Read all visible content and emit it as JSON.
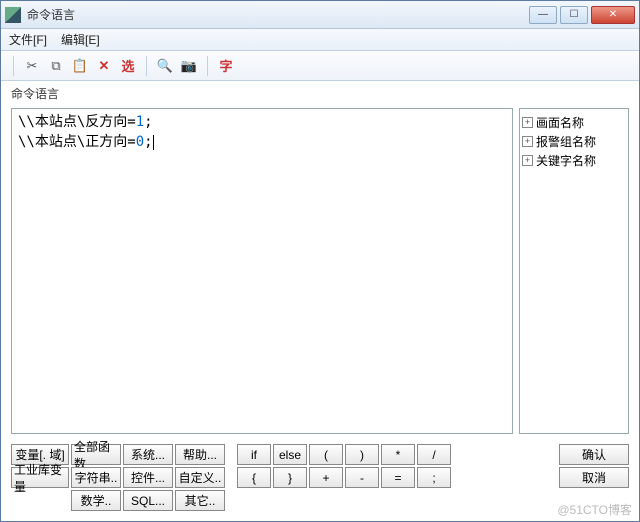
{
  "window": {
    "title": "命令语言"
  },
  "menu": {
    "file": "文件[F]",
    "edit": "编辑[E]"
  },
  "toolbar": {
    "cut": "✂",
    "copy": "⧉",
    "paste": "📋",
    "delete": "✕",
    "select": "选",
    "find": "🔍",
    "camera": "📷",
    "font": "字"
  },
  "panel": {
    "label": "命令语言"
  },
  "code": {
    "lines": [
      {
        "pre": "\\\\本站点\\反方向=",
        "val": "1",
        "post": ";"
      },
      {
        "pre": "\\\\本站点\\正方向=",
        "val": "0",
        "post": ";"
      }
    ]
  },
  "tree": {
    "items": [
      "画面名称",
      "报警组名称",
      "关键字名称"
    ]
  },
  "bottom": {
    "var": "变量[. 域]",
    "indvar": "工业库变量",
    "allfn": "全部函数",
    "str": "字符串..",
    "math": "数学..",
    "sys": "系统...",
    "ctrl": "控件...",
    "sql": "SQL...",
    "help": "帮助...",
    "custom": "自定义..",
    "other": "其它..",
    "ok": "确认",
    "cancel": "取消"
  },
  "sym": {
    "if": "if",
    "else": "else",
    "lp": "(",
    "rp": ")",
    "mul": "*",
    "div": "/",
    "lb": "{",
    "rb": "}",
    "plus": "+",
    "minus": "-",
    "eq": "=",
    "semi": ";"
  },
  "watermark": "@51CTO博客"
}
